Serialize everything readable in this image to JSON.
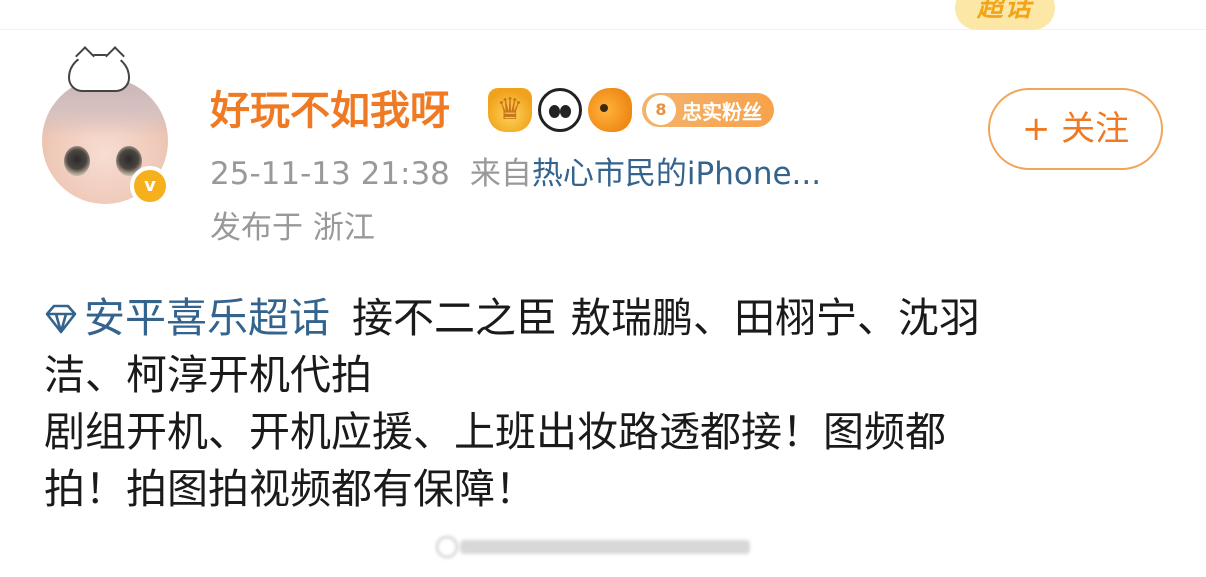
{
  "header": {
    "super_topic_logo": "超话"
  },
  "user": {
    "name": "好玩不如我呀",
    "verified_mark": "v",
    "fan_badge_level": "8",
    "fan_badge_label": "忠实粉丝",
    "badge_icons": [
      "crown-icon",
      "panda-icon",
      "fish-icon"
    ]
  },
  "meta": {
    "timestamp": "25-11-13 21:38",
    "from_label": "来自",
    "device": "热心市民的iPhone...",
    "location": "发布于 浙江"
  },
  "actions": {
    "follow_label": "+ 关注"
  },
  "post": {
    "topic": "安平喜乐超话",
    "lines": [
      "接不二之臣 敖瑞鹏、田栩宁、沈羽",
      "洁、柯淳开机代拍",
      "剧组开机、开机应援、上班出妆路透都接！图频都",
      "拍！拍图拍视频都有保障！"
    ]
  },
  "colors": {
    "accent_orange": "#ef7a23",
    "link_blue": "#34648e",
    "meta_gray": "#999999",
    "verified_gold": "#f6b01c"
  }
}
